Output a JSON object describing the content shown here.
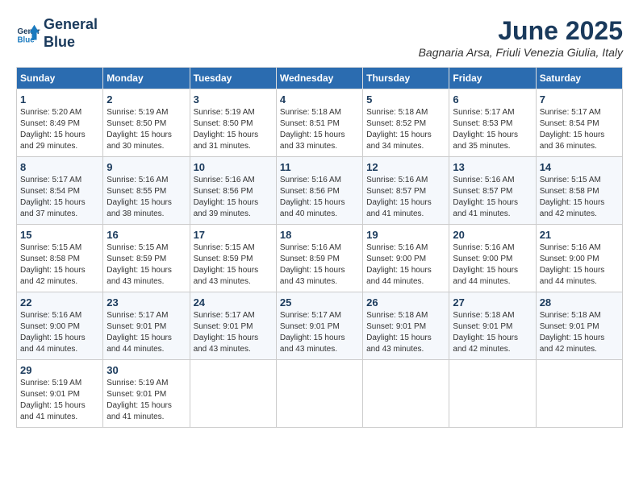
{
  "logo": {
    "line1": "General",
    "line2": "Blue"
  },
  "title": "June 2025",
  "location": "Bagnaria Arsa, Friuli Venezia Giulia, Italy",
  "weekdays": [
    "Sunday",
    "Monday",
    "Tuesday",
    "Wednesday",
    "Thursday",
    "Friday",
    "Saturday"
  ],
  "weeks": [
    [
      {
        "day": "1",
        "sunrise": "5:20 AM",
        "sunset": "8:49 PM",
        "daylight": "15 hours and 29 minutes."
      },
      {
        "day": "2",
        "sunrise": "5:19 AM",
        "sunset": "8:50 PM",
        "daylight": "15 hours and 30 minutes."
      },
      {
        "day": "3",
        "sunrise": "5:19 AM",
        "sunset": "8:50 PM",
        "daylight": "15 hours and 31 minutes."
      },
      {
        "day": "4",
        "sunrise": "5:18 AM",
        "sunset": "8:51 PM",
        "daylight": "15 hours and 33 minutes."
      },
      {
        "day": "5",
        "sunrise": "5:18 AM",
        "sunset": "8:52 PM",
        "daylight": "15 hours and 34 minutes."
      },
      {
        "day": "6",
        "sunrise": "5:17 AM",
        "sunset": "8:53 PM",
        "daylight": "15 hours and 35 minutes."
      },
      {
        "day": "7",
        "sunrise": "5:17 AM",
        "sunset": "8:54 PM",
        "daylight": "15 hours and 36 minutes."
      }
    ],
    [
      {
        "day": "8",
        "sunrise": "5:17 AM",
        "sunset": "8:54 PM",
        "daylight": "15 hours and 37 minutes."
      },
      {
        "day": "9",
        "sunrise": "5:16 AM",
        "sunset": "8:55 PM",
        "daylight": "15 hours and 38 minutes."
      },
      {
        "day": "10",
        "sunrise": "5:16 AM",
        "sunset": "8:56 PM",
        "daylight": "15 hours and 39 minutes."
      },
      {
        "day": "11",
        "sunrise": "5:16 AM",
        "sunset": "8:56 PM",
        "daylight": "15 hours and 40 minutes."
      },
      {
        "day": "12",
        "sunrise": "5:16 AM",
        "sunset": "8:57 PM",
        "daylight": "15 hours and 41 minutes."
      },
      {
        "day": "13",
        "sunrise": "5:16 AM",
        "sunset": "8:57 PM",
        "daylight": "15 hours and 41 minutes."
      },
      {
        "day": "14",
        "sunrise": "5:15 AM",
        "sunset": "8:58 PM",
        "daylight": "15 hours and 42 minutes."
      }
    ],
    [
      {
        "day": "15",
        "sunrise": "5:15 AM",
        "sunset": "8:58 PM",
        "daylight": "15 hours and 42 minutes."
      },
      {
        "day": "16",
        "sunrise": "5:15 AM",
        "sunset": "8:59 PM",
        "daylight": "15 hours and 43 minutes."
      },
      {
        "day": "17",
        "sunrise": "5:15 AM",
        "sunset": "8:59 PM",
        "daylight": "15 hours and 43 minutes."
      },
      {
        "day": "18",
        "sunrise": "5:16 AM",
        "sunset": "8:59 PM",
        "daylight": "15 hours and 43 minutes."
      },
      {
        "day": "19",
        "sunrise": "5:16 AM",
        "sunset": "9:00 PM",
        "daylight": "15 hours and 44 minutes."
      },
      {
        "day": "20",
        "sunrise": "5:16 AM",
        "sunset": "9:00 PM",
        "daylight": "15 hours and 44 minutes."
      },
      {
        "day": "21",
        "sunrise": "5:16 AM",
        "sunset": "9:00 PM",
        "daylight": "15 hours and 44 minutes."
      }
    ],
    [
      {
        "day": "22",
        "sunrise": "5:16 AM",
        "sunset": "9:00 PM",
        "daylight": "15 hours and 44 minutes."
      },
      {
        "day": "23",
        "sunrise": "5:17 AM",
        "sunset": "9:01 PM",
        "daylight": "15 hours and 44 minutes."
      },
      {
        "day": "24",
        "sunrise": "5:17 AM",
        "sunset": "9:01 PM",
        "daylight": "15 hours and 43 minutes."
      },
      {
        "day": "25",
        "sunrise": "5:17 AM",
        "sunset": "9:01 PM",
        "daylight": "15 hours and 43 minutes."
      },
      {
        "day": "26",
        "sunrise": "5:18 AM",
        "sunset": "9:01 PM",
        "daylight": "15 hours and 43 minutes."
      },
      {
        "day": "27",
        "sunrise": "5:18 AM",
        "sunset": "9:01 PM",
        "daylight": "15 hours and 42 minutes."
      },
      {
        "day": "28",
        "sunrise": "5:18 AM",
        "sunset": "9:01 PM",
        "daylight": "15 hours and 42 minutes."
      }
    ],
    [
      {
        "day": "29",
        "sunrise": "5:19 AM",
        "sunset": "9:01 PM",
        "daylight": "15 hours and 41 minutes."
      },
      {
        "day": "30",
        "sunrise": "5:19 AM",
        "sunset": "9:01 PM",
        "daylight": "15 hours and 41 minutes."
      },
      null,
      null,
      null,
      null,
      null
    ]
  ],
  "labels": {
    "sunrise": "Sunrise:",
    "sunset": "Sunset:",
    "daylight": "Daylight:"
  }
}
